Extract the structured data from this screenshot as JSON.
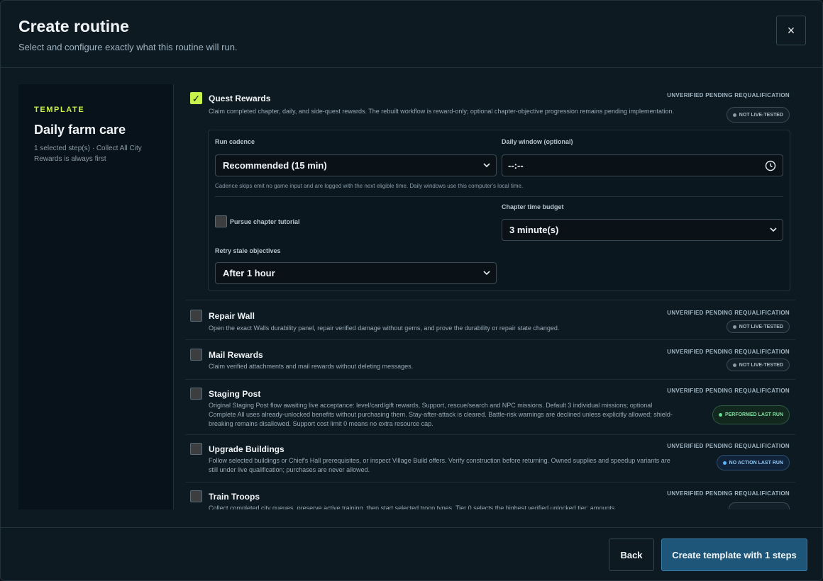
{
  "header": {
    "title": "Create routine",
    "subtitle": "Select and configure exactly what this routine will run.",
    "close_glyph": "×"
  },
  "sidebar": {
    "eyebrow": "TEMPLATE",
    "name": "Daily farm care",
    "meta": "1 selected step(s) · Collect All City Rewards is always first"
  },
  "steps": [
    {
      "title": "Quest Rewards",
      "desc": "Claim completed chapter, daily, and side-quest rewards. The rebuilt workflow is reward-only; optional chapter-objective progression remains pending implementation.",
      "status": "UNVERIFIED PENDING REQUALIFICATION",
      "pill": "NOT LIVE-TESTED",
      "checked": true
    },
    {
      "title": "Repair Wall",
      "desc": "Open the exact Walls durability panel, repair verified damage without gems, and prove the durability or repair state changed.",
      "status": "UNVERIFIED PENDING REQUALIFICATION",
      "pill": "NOT LIVE-TESTED",
      "checked": false
    },
    {
      "title": "Mail Rewards",
      "desc": "Claim verified attachments and mail rewards without deleting messages.",
      "status": "UNVERIFIED PENDING REQUALIFICATION",
      "pill": "NOT LIVE-TESTED",
      "checked": false
    },
    {
      "title": "Staging Post",
      "desc": "Original Staging Post flow awaiting live acceptance: level/card/gift rewards, Support, rescue/search and NPC missions. Default 3 individual missions; optional Complete All uses already-unlocked benefits without purchasing them. Stay-after-attack is cleared. Battle-risk warnings are declined unless explicitly allowed; shield-breaking remains disallowed. Support cost limit 0 means no extra resource cap.",
      "status": "UNVERIFIED PENDING REQUALIFICATION",
      "pill": "PERFORMED LAST RUN",
      "checked": false
    },
    {
      "title": "Upgrade Buildings",
      "desc": "Follow selected buildings or Chief's Hall prerequisites, or inspect Village Build offers. Verify construction before returning. Owned supplies and speedup variants are still under live qualification; purchases are never allowed.",
      "status": "UNVERIFIED PENDING REQUALIFICATION",
      "pill": "NO ACTION LAST RUN",
      "checked": false
    },
    {
      "title": "Train Troops",
      "desc": "Collect completed city queues, preserve active training, then start selected troop types. Tier 0 selects the highest verified unlocked tier; amounts",
      "status": "UNVERIFIED PENDING REQUALIFICATION",
      "checked": false
    }
  ],
  "config": {
    "cadence_label": "Run cadence",
    "cadence_value": "Recommended (15 min)",
    "window_label": "Daily window (optional)",
    "window_value": "--:--",
    "hint": "Cadence skips emit no game input and are logged with the next eligible time. Daily windows use this computer's local time.",
    "tutorial_label": "Pursue chapter tutorial",
    "budget_label": "Chapter time budget",
    "budget_value": "3 minute(s)",
    "retry_label": "Retry stale objectives",
    "retry_value": "After 1 hour"
  },
  "footer": {
    "back_label": "Back",
    "create_label": "Create template with 1 steps"
  },
  "colors": {
    "accent": "#c6f24b",
    "primary_button": "#1d5679",
    "background": "#0e1a22"
  }
}
